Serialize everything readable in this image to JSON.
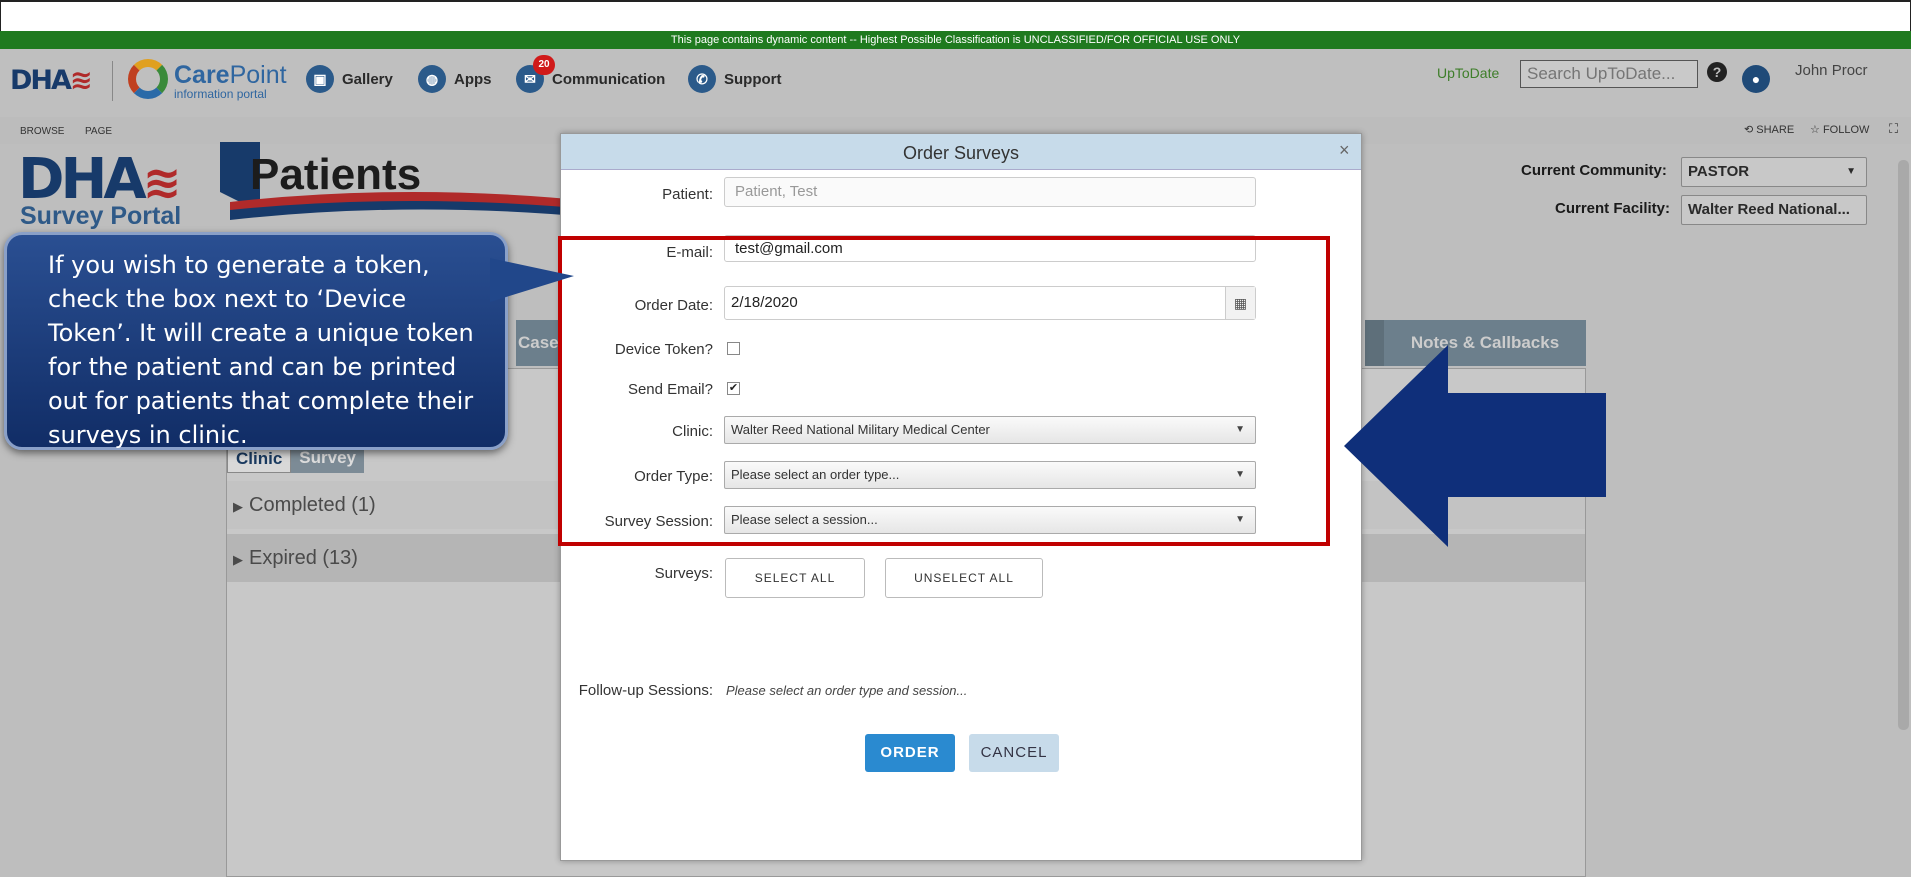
{
  "classification_banner": "This page contains dynamic content -- Highest Possible Classification is UNCLASSIFIED/FOR OFFICIAL USE ONLY",
  "header": {
    "dha_logo": "DHA",
    "carepoint_brand_a": "Care",
    "carepoint_brand_b": "Point",
    "carepoint_sub": "information portal",
    "nav": [
      {
        "label": "Gallery",
        "icon": "gallery-icon"
      },
      {
        "label": "Apps",
        "icon": "globe-icon"
      },
      {
        "label": "Communication",
        "icon": "chat-icon",
        "badge": "20"
      },
      {
        "label": "Support",
        "icon": "phone-icon"
      }
    ],
    "uptodate_label": "UpToDate",
    "search_placeholder": "Search UpToDate...",
    "user_name": "John Procr"
  },
  "ribbon": {
    "browse": "BROWSE",
    "page": "PAGE",
    "share": "SHARE",
    "follow": "FOLLOW"
  },
  "portal": {
    "logo": "DHA",
    "name": "Survey Portal",
    "page_title": "Patients",
    "current_community_label": "Current Community:",
    "current_community_value": "PASTOR",
    "current_facility_label": "Current Facility:",
    "current_facility_value": "Walter Reed National..."
  },
  "background_tabs": {
    "case": "Case",
    "notes": "Notes & Callbacks",
    "clinic": "Clinic",
    "survey": "Survey",
    "completed": "Completed (1)",
    "expired": "Expired (13)"
  },
  "callout": {
    "text": "If you wish to generate a token, check the box next to ‘Device Token’. It will create a unique token for the patient and can be printed out for patients that complete their surveys in clinic."
  },
  "modal": {
    "title": "Order Surveys",
    "close": "×",
    "patient_label": "Patient:",
    "patient_value": "Patient, Test",
    "email_label": "E-mail:",
    "email_value": "test@gmail.com",
    "order_date_label": "Order Date:",
    "order_date_value": "2/18/2020",
    "device_token_label": "Device Token?",
    "device_token_checked": false,
    "send_email_label": "Send Email?",
    "send_email_checked": true,
    "clinic_label": "Clinic:",
    "clinic_value": "Walter Reed National Military Medical Center",
    "order_type_label": "Order Type:",
    "order_type_placeholder": "Please select an order type...",
    "session_label": "Survey Session:",
    "session_placeholder": "Please select a session...",
    "surveys_label": "Surveys:",
    "select_all": "SELECT ALL",
    "unselect_all": "UNSELECT ALL",
    "followup_label": "Follow-up Sessions:",
    "followup_value": "Please select an order type and session...",
    "order_button": "ORDER",
    "cancel_button": "CANCEL"
  },
  "colors": {
    "classification_green": "#1f7a1f",
    "highlight_red": "#c00000",
    "arrow_blue": "#0f2f7a",
    "order_blue": "#2a8ad0"
  }
}
